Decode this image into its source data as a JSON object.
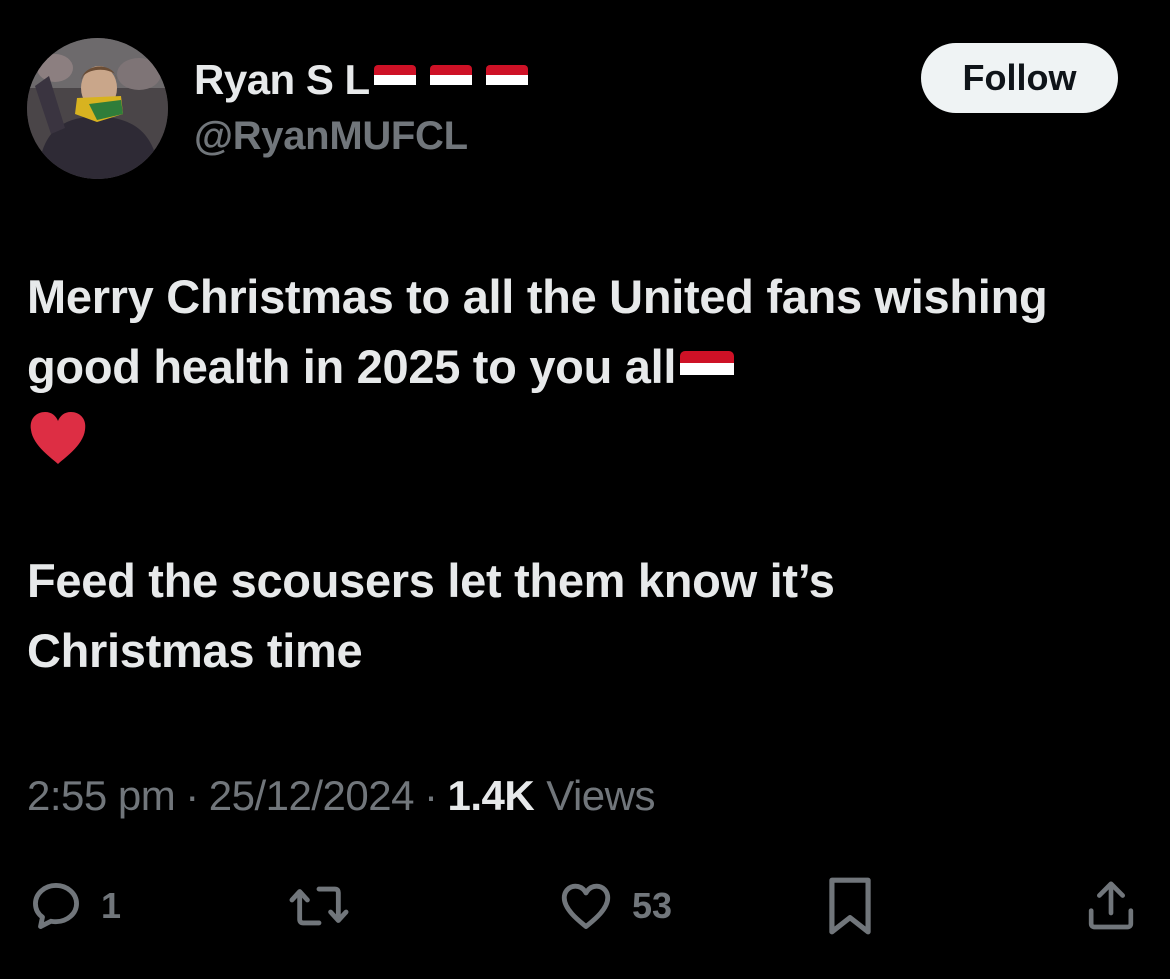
{
  "author": {
    "display_name": "Ryan S L",
    "handle": "@RyanMUFCL",
    "name_flags": [
      "flag-icon",
      "flag-icon",
      "flag-icon"
    ]
  },
  "follow_label": "Follow",
  "tweet": {
    "paragraph1": "Merry Christmas to all the United fans wishing good health in 2025 to you all",
    "paragraph1_emojis": [
      "flag-icon",
      "red-heart-emoji"
    ],
    "paragraph2": "Feed the scousers let them know it’s Christmas time"
  },
  "meta": {
    "time": "2:55 pm",
    "separator": "·",
    "date": "25/12/2024",
    "views_count": "1.4K",
    "views_label": "Views"
  },
  "actions": {
    "reply_count": "1",
    "retweet_count": "",
    "like_count": "53"
  },
  "icons": {
    "reply": "reply-icon",
    "retweet": "retweet-icon",
    "like": "heart-icon",
    "bookmark": "bookmark-icon",
    "share": "share-icon"
  },
  "colors": {
    "background": "#000000",
    "text_primary": "#e7e9ea",
    "text_secondary": "#71767b",
    "follow_button_bg": "#eff3f4",
    "follow_button_text": "#0f1419",
    "heart_emoji": "#dd2e44"
  }
}
